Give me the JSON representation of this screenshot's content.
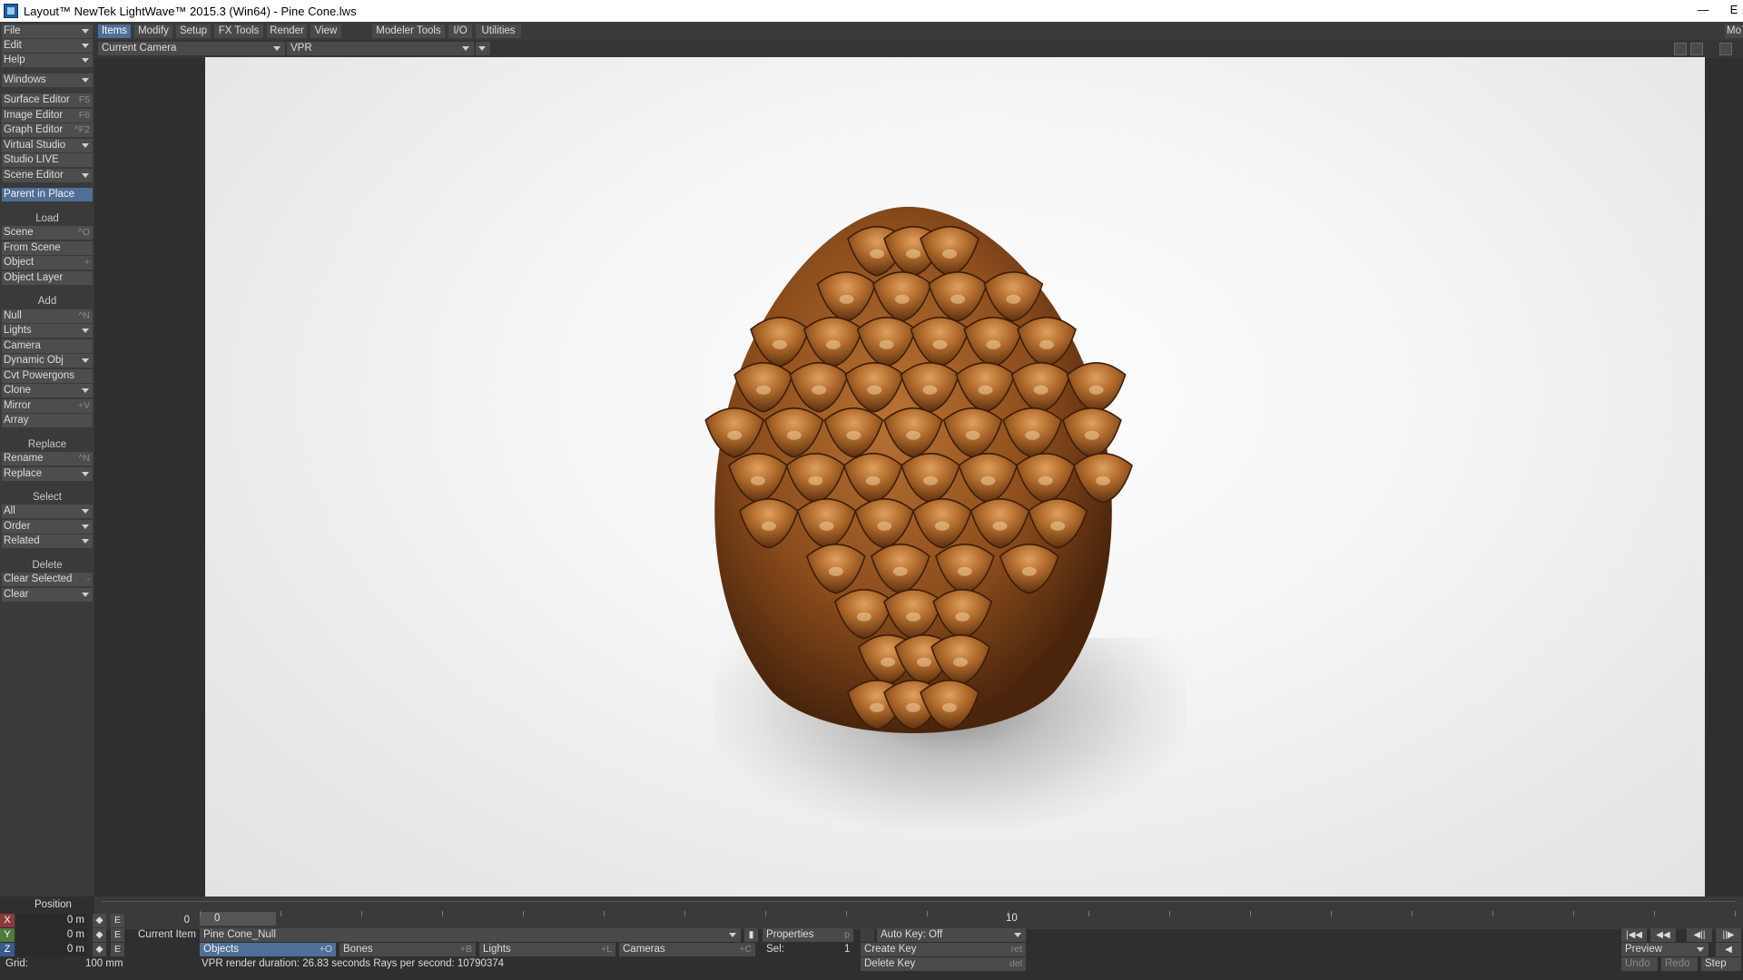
{
  "window": {
    "title": "Layout™ NewTek LightWave™ 2015.3 (Win64) - Pine Cone.lws",
    "minimize": "—",
    "partial_right": "E"
  },
  "menu": {
    "file": "File",
    "edit": "Edit",
    "help": "Help",
    "windows": "Windows",
    "surface_editor": "Surface Editor",
    "surface_editor_sc": "F5",
    "image_editor": "Image Editor",
    "image_editor_sc": "F6",
    "graph_editor": "Graph Editor",
    "graph_editor_sc": "^F2",
    "virtual_studio": "Virtual Studio",
    "studio_live": "Studio LIVE",
    "scene_editor": "Scene Editor",
    "parent_in_place": "Parent in Place",
    "load_header": "Load",
    "scene": "Scene",
    "scene_sc": "^O",
    "from_scene": "From Scene",
    "object": "Object",
    "object_sc": "+",
    "object_layer": "Object Layer",
    "add_header": "Add",
    "null": "Null",
    "null_sc": "^N",
    "lights": "Lights",
    "camera": "Camera",
    "dynamic_obj": "Dynamic Obj",
    "cvt_powergons": "Cvt Powergons",
    "clone": "Clone",
    "mirror": "Mirror",
    "mirror_sc": "+V",
    "array": "Array",
    "replace_header": "Replace",
    "rename": "Rename",
    "rename_sc": "^N",
    "replace": "Replace",
    "select_header": "Select",
    "all": "All",
    "order": "Order",
    "related": "Related",
    "delete_header": "Delete",
    "clear_selected": "Clear Selected",
    "clear_selected_sc": "-",
    "clear": "Clear"
  },
  "tabs": [
    "Items",
    "Modify",
    "Setup",
    "FX Tools",
    "Render",
    "View",
    "Modeler Tools",
    "I/O",
    "Utilities"
  ],
  "tabs_right": "Mo",
  "viewbar": {
    "camera": "Current Camera",
    "mode": "VPR"
  },
  "timeline": {
    "current_frame": "0",
    "label_0": "0",
    "label_10": "10"
  },
  "bottom": {
    "position_label": "Position",
    "x_label": "X",
    "y_label": "Y",
    "z_label": "Z",
    "x_value": "0 m",
    "y_value": "0 m",
    "z_value": "0 m",
    "e_label": "E",
    "frame_field": "0",
    "current_item_label": "Current Item",
    "current_item": "Pine Cone_Null",
    "properties": "Properties",
    "properties_sc": "p",
    "auto_key": "Auto Key: Off",
    "objects": "Objects",
    "objects_sc": "+O",
    "bones": "Bones",
    "bones_sc": "+B",
    "lights": "Lights",
    "lights_sc": "+L",
    "cameras": "Cameras",
    "cameras_sc": "+C",
    "sel_label": "Sel:",
    "sel_value": "1",
    "create_key": "Create Key",
    "create_key_sc": "ret",
    "delete_key": "Delete Key",
    "delete_key_sc": "del",
    "grid_label": "Grid:",
    "grid_value": "100 mm",
    "status": "VPR render duration: 26.83 seconds  Rays per second: 10790374",
    "preview": "Preview",
    "undo": "Undo",
    "redo": "Redo",
    "step": "Step"
  },
  "colors": {
    "accent": "#4f6f97",
    "panel": "#3a3a3a",
    "button": "#4d4d4d",
    "viewport_bg": "#f2f2f2",
    "cone_dark": "#5a2f10",
    "cone_light": "#c8853f"
  }
}
